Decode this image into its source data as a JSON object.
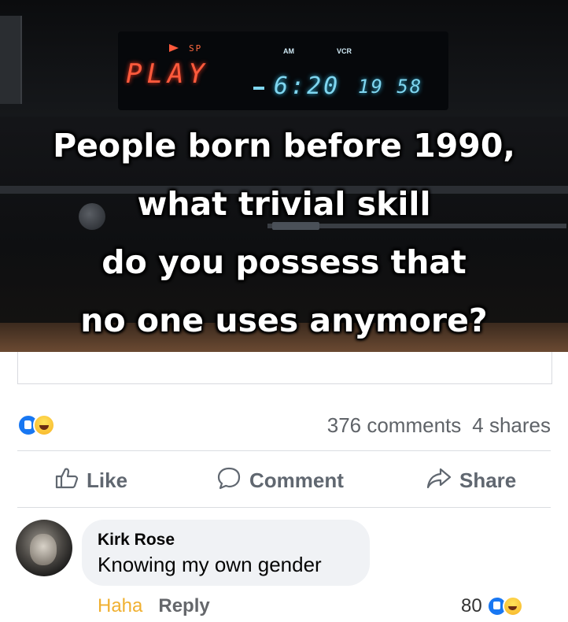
{
  "meme": {
    "vcr_display": {
      "mode": "PLAY",
      "speed": "SP",
      "clock": "6:20",
      "counter": "19 58",
      "am_label": "AM",
      "vcr_label": "VCR"
    },
    "caption_lines": [
      "People born before 1990,",
      "what trivial skill",
      "do you possess that",
      "no one uses anymore?"
    ]
  },
  "post_stats": {
    "reaction_icons": [
      "like-icon",
      "haha-icon"
    ],
    "comments": "376 comments",
    "shares": "4 shares"
  },
  "actions": {
    "like": "Like",
    "comment": "Comment",
    "share": "Share"
  },
  "comment": {
    "author": "Kirk Rose",
    "text": "Knowing my own gender",
    "haha_label": "Haha",
    "reply_label": "Reply",
    "reaction_count": "80",
    "reaction_icons": [
      "like-icon",
      "haha-icon"
    ]
  },
  "colors": {
    "like_blue": "#1877f2",
    "haha_yellow": "#f7b125",
    "secondary_text": "#65676b",
    "bubble_bg": "#f0f2f5"
  }
}
